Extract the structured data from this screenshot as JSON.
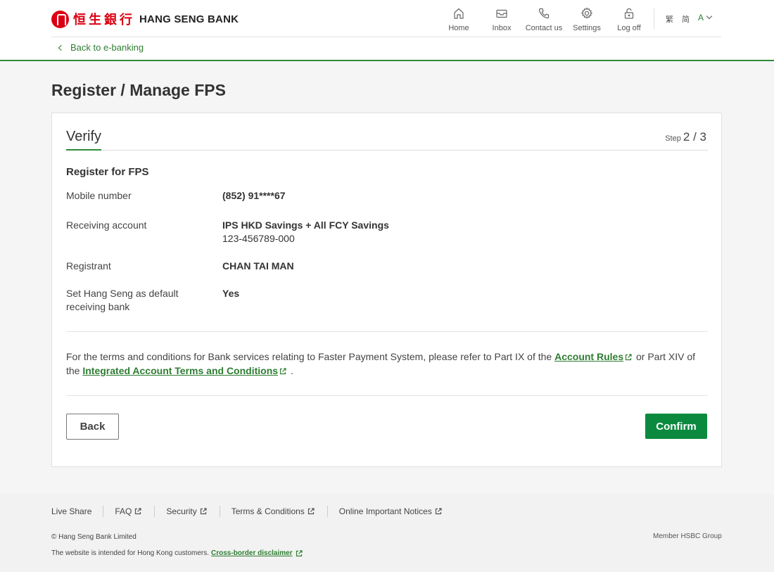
{
  "header": {
    "logo_cn": "恒生銀行",
    "logo_en": "HANG SENG BANK",
    "nav": [
      {
        "label": "Home",
        "icon": "home-icon"
      },
      {
        "label": "Inbox",
        "icon": "inbox-icon"
      },
      {
        "label": "Contact us",
        "icon": "phone-icon"
      },
      {
        "label": "Settings",
        "icon": "gear-icon"
      },
      {
        "label": "Log off",
        "icon": "lock-icon"
      }
    ],
    "lang_traditional": "繁",
    "lang_simplified": "简",
    "font_size": "A",
    "back_link": "Back to e-banking"
  },
  "page": {
    "title": "Register / Manage FPS",
    "step_title": "Verify",
    "step_word": "Step",
    "step_value": "2 / 3",
    "section_title": "Register for FPS",
    "rows": [
      {
        "label": "Mobile number",
        "value": "(852) 91****67"
      },
      {
        "label": "Receiving account",
        "value": "IPS HKD Savings + All FCY Savings",
        "sub": "123-456789-000"
      },
      {
        "label": "Registrant",
        "value": "CHAN TAI MAN"
      },
      {
        "label": "Set Hang Seng as default receiving bank",
        "value": "Yes"
      }
    ],
    "terms_text_1": "For the terms and conditions for Bank services relating to Faster Payment System, please refer to Part IX of the",
    "terms_link_1": "Account Rules",
    "terms_text_2": "or Part XIV of the",
    "terms_link_2": "Integrated Account Terms and Conditions",
    "terms_text_3": ".",
    "back_button": "Back",
    "confirm_button": "Confirm"
  },
  "footer": {
    "links": [
      "Live Share",
      "FAQ",
      "Security",
      "Terms & Conditions",
      "Online Important Notices"
    ],
    "copyright": "© Hang Seng Bank Limited",
    "member": "Member HSBC Group",
    "disclaimer_text": "The website is intended for Hong Kong customers.",
    "disclaimer_link": "Cross-border disclaimer"
  },
  "colors": {
    "brand_red": "#db0011",
    "brand_green": "#2e8b3a",
    "confirm_green": "#0b8a3f"
  }
}
